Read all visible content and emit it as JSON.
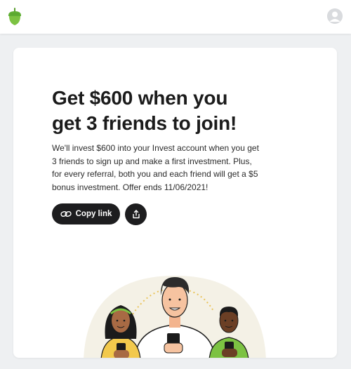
{
  "header": {
    "logo_icon": "acorn-icon",
    "avatar_icon": "user-avatar-icon"
  },
  "promo": {
    "headline_line1": "Get $600 when you",
    "headline_line2": "get 3 friends to join!",
    "description": "We'll invest $600 into your Invest account when you get 3 friends to sign up and make a first investment. Plus, for every referral, both you and each friend will get a $5 bonus investment. Offer ends 11/06/2021!",
    "copy_link_label": "Copy link",
    "copy_link_icon": "link-icon",
    "share_icon": "share-icon"
  },
  "colors": {
    "brand_green": "#7cc242",
    "button_dark": "#1d1d1f",
    "page_bg": "#eef0f2"
  }
}
